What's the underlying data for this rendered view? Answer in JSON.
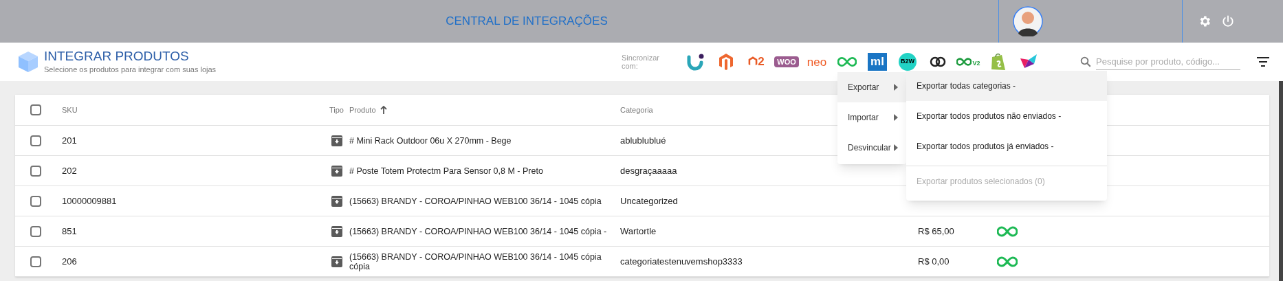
{
  "header": {
    "title": "CENTRAL DE INTEGRAÇÕES"
  },
  "page": {
    "title": "INTEGRAR PRODUTOS",
    "subtitle": "Selecione os produtos para integrar com suas lojas"
  },
  "sync": {
    "label": "Sincronizar com:",
    "logos": [
      {
        "kind": "u"
      },
      {
        "kind": "magento"
      },
      {
        "kind": "magento2",
        "text": "2"
      },
      {
        "kind": "woo",
        "text": "WOO"
      },
      {
        "kind": "neo",
        "text": "neo"
      },
      {
        "kind": "infinity"
      },
      {
        "kind": "ml",
        "text": "ml"
      },
      {
        "kind": "b2w",
        "text": "B2W"
      },
      {
        "kind": "rings"
      },
      {
        "kind": "infinity_v2",
        "text": "V2"
      },
      {
        "kind": "shopify"
      },
      {
        "kind": "star"
      }
    ]
  },
  "search": {
    "placeholder": "Pesquise por produto, código..."
  },
  "table": {
    "select_all": {
      "checked": false
    },
    "columns": [
      "SKU",
      "Tipo",
      "Produto",
      "Categoria"
    ],
    "rows": [
      {
        "checked": false,
        "sku": "201",
        "produto": "# Mini Rack Outdoor 06u X 270mm - Bege",
        "categoria": "ablublublué"
      },
      {
        "checked": false,
        "sku": "202",
        "produto": "# Poste Totem Protectm Para Sensor 0,8 M - Preto",
        "categoria": "desgraçaaaaa"
      },
      {
        "checked": false,
        "sku": "10000009881",
        "produto": "(15663) BRANDY - COROA/PINHAO WEB100 36/14 - 1045 cópia",
        "categoria": "Uncategorized"
      },
      {
        "checked": false,
        "sku": "851",
        "produto": "(15663) BRANDY - COROA/PINHAO WEB100 36/14 - 1045 cópia -",
        "categoria": "Wartortle",
        "preco": "R$ 65,00",
        "integrations": [
          {
            "kind": "infinity"
          }
        ]
      },
      {
        "checked": false,
        "sku": "206",
        "produto": "(15663) BRANDY - COROA/PINHAO WEB100 36/14 - 1045 cópia cópia",
        "categoria": "categoriatestenuvemshop3333",
        "preco": "R$ 0,00",
        "integrations": [
          {
            "kind": "infinity"
          }
        ]
      }
    ]
  },
  "menu": {
    "items": [
      {
        "label": "Exportar",
        "selected": true
      },
      {
        "label": "Importar",
        "selected": false
      },
      {
        "label": "Desvincular",
        "selected": false
      }
    ],
    "submenu": [
      {
        "label": "Exportar todas categorias -",
        "selected": true,
        "disabled": false
      },
      {
        "label": "Exportar todos produtos não enviados -",
        "selected": false,
        "disabled": false
      },
      {
        "label": "Exportar todos produtos já enviados -",
        "selected": false,
        "disabled": false
      },
      {
        "label": "Exportar produtos selecionados (0)",
        "selected": false,
        "disabled": true
      }
    ]
  }
}
